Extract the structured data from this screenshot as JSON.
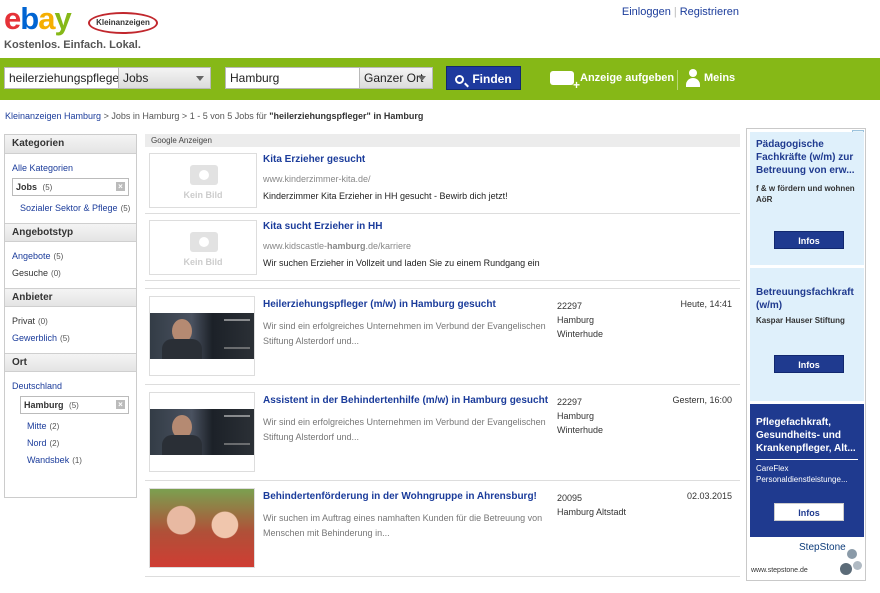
{
  "logo": {
    "brand": "ebay",
    "badge": "Kleinanzeigen",
    "tagline": "Kostenlos. Einfach. Lokal."
  },
  "top_links": {
    "login": "Einloggen",
    "register": "Registrieren"
  },
  "search": {
    "query": "heilerziehungspfleger",
    "category": "Jobs",
    "location": "Hamburg",
    "radius": "Ganzer Ort",
    "find_label": "Finden"
  },
  "nav": {
    "post_ad": "Anzeige aufgeben",
    "mine": "Meins"
  },
  "breadcrumb": {
    "home": "Kleinanzeigen Hamburg",
    "sep": ">",
    "jobs": "Jobs in Hamburg",
    "result_prefix": "1 - 5 von 5 Jobs für",
    "query_quoted": "\"heilerziehungspfleger\" in Hamburg"
  },
  "sidebar": {
    "kategorien": {
      "title": "Kategorien",
      "all": "Alle Kategorien",
      "selected": {
        "label": "Jobs",
        "count": "(5)"
      },
      "sub": {
        "label": "Sozialer Sektor & Pflege",
        "count": "(5)"
      }
    },
    "angebotstyp": {
      "title": "Angebotstyp",
      "items": [
        {
          "label": "Angebote",
          "count": "(5)"
        },
        {
          "label": "Gesuche",
          "count": "(0)"
        }
      ]
    },
    "anbieter": {
      "title": "Anbieter",
      "items": [
        {
          "label": "Privat",
          "count": "(0)"
        },
        {
          "label": "Gewerblich",
          "count": "(5)"
        }
      ]
    },
    "ort": {
      "title": "Ort",
      "country": "Deutschland",
      "selected": {
        "label": "Hamburg",
        "count": "(5)"
      },
      "districts": [
        {
          "label": "Mitte",
          "count": "(2)"
        },
        {
          "label": "Nord",
          "count": "(2)"
        },
        {
          "label": "Wandsbek",
          "count": "(1)"
        }
      ]
    }
  },
  "google_label": "Google Anzeigen",
  "ads": [
    {
      "title": "Kita Erzieher gesucht",
      "url": "www.kinderzimmer-kita.de/",
      "desc": "Kinderzimmer Kita Erzieher in HH gesucht - Bewirb dich jetzt!",
      "no_image": "Kein Bild"
    },
    {
      "title": "Kita sucht Erzieher in HH",
      "url_prefix": "www.kidscastle-",
      "url_bold": "hamburg",
      "url_suffix": ".de/karriere",
      "desc": "Wir suchen Erzieher in Vollzeit und laden Sie zu einem Rundgang ein",
      "no_image": "Kein Bild"
    }
  ],
  "listings": [
    {
      "title": "Heilerziehungspfleger (m/w) in Hamburg gesucht",
      "desc": "Wir sind ein erfolgreiches Unternehmen im Verbund der Evangelischen Stiftung Alsterdorf und...",
      "zip": "22297",
      "city": "Hamburg",
      "district": "Winterhude",
      "date": "Heute, 14:41"
    },
    {
      "title": "Assistent in der Behindertenhilfe (m/w) in Hamburg gesucht",
      "desc": "Wir sind ein erfolgreiches Unternehmen im Verbund der Evangelischen Stiftung Alsterdorf und...",
      "zip": "22297",
      "city": "Hamburg",
      "district": "Winterhude",
      "date": "Gestern, 16:00"
    },
    {
      "title": "Behindertenförderung in der Wohngruppe in Ahrensburg!",
      "desc": "Wir suchen im Auftrag eines namhaften Kunden für die Betreuung von Menschen mit Behinderung in...",
      "zip": "20095",
      "city": "Hamburg Altstadt",
      "district": "",
      "date": "02.03.2015"
    }
  ],
  "banner": {
    "blocks": [
      {
        "title": "Pädagogische Fachkräfte (w/m) zur Betreuung von erw...",
        "sub": "f & w fördern und wohnen AöR",
        "button": "Infos"
      },
      {
        "title": "Betreuungsfachkraft (w/m)",
        "sub": "Kaspar Hauser Stiftung",
        "button": "Infos"
      },
      {
        "title": "Pflegefachkraft, Gesundheits- und Krankenpfleger, Alt...",
        "sub": "CareFlex Personaldienstleistunge...",
        "button": "Infos"
      }
    ],
    "brand": "StepStone",
    "url": "www.stepstone.de",
    "ad_marker": "▷"
  },
  "colors": {
    "green_bar": "#86b817",
    "link_blue": "#1b3c9b",
    "button_blue": "#1e3a9e",
    "banner_light": "#dff0fb",
    "banner_dark": "#1f3a8f"
  }
}
